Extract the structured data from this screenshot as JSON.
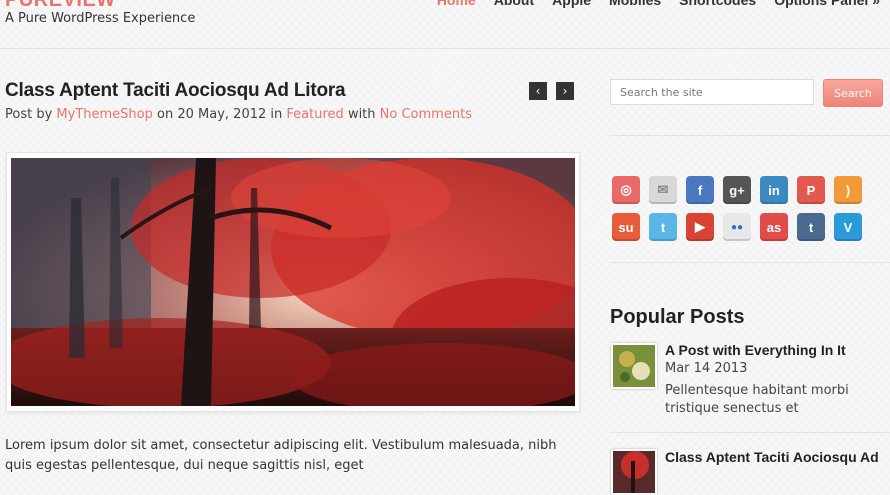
{
  "header": {
    "site_title": "PUREVIEW",
    "tagline": "A Pure WordPress Experience",
    "nav": [
      "Home",
      "About",
      "Apple",
      "Mobiles",
      "Shortcodes",
      "Options Panel »"
    ],
    "active_nav": "Home"
  },
  "post": {
    "title": "Class Aptent Taciti Aociosqu Ad Litora",
    "meta": {
      "prefix": "Post by",
      "author": "MyThemeShop",
      "on": "on",
      "date": "20 May, 2012",
      "in": "in",
      "category": "Featured",
      "with": "with",
      "comments": "No Comments"
    },
    "prev_icon": "‹",
    "next_icon": "›",
    "excerpt": "Lorem ipsum dolor sit amet, consectetur adipiscing elit. Vestibulum malesuada, nibh quis egestas pellentesque, dui neque sagittis nisl, eget"
  },
  "sidebar": {
    "search": {
      "placeholder": "Search the site",
      "button": "Search"
    },
    "social": [
      {
        "name": "dribbble-icon",
        "glyph": "◎",
        "color": "#ea6a6a"
      },
      {
        "name": "email-icon",
        "glyph": "✉",
        "color": "#d8d8d8"
      },
      {
        "name": "facebook-icon",
        "glyph": "f",
        "color": "#4a79c2"
      },
      {
        "name": "google-plus-icon",
        "glyph": "g+",
        "color": "#555555"
      },
      {
        "name": "linkedin-icon",
        "glyph": "in",
        "color": "#3b8bc2"
      },
      {
        "name": "pinterest-icon",
        "glyph": "P",
        "color": "#e4594e"
      },
      {
        "name": "rss-icon",
        "glyph": ")",
        "color": "#f09a3a"
      },
      {
        "name": "stumbleupon-icon",
        "glyph": "su",
        "color": "#ea5b3a"
      },
      {
        "name": "twitter-icon",
        "glyph": "t",
        "color": "#59b6e6"
      },
      {
        "name": "youtube-icon",
        "glyph": "▶",
        "color": "#d84334"
      },
      {
        "name": "flickr-icon",
        "glyph": "●●",
        "color": "#e8e8e8"
      },
      {
        "name": "lastfm-icon",
        "glyph": "as",
        "color": "#e14c48"
      },
      {
        "name": "tumblr-icon",
        "glyph": "t",
        "color": "#4a6a8f"
      },
      {
        "name": "vimeo-icon",
        "glyph": "V",
        "color": "#2a9ad8"
      }
    ],
    "popular_title": "Popular Posts",
    "popular_posts": [
      {
        "title": "A Post with Everything In It",
        "date": "Mar 14 2013",
        "excerpt": "Pellentesque habitant morbi tristique senectus et"
      },
      {
        "title": "Class Aptent Taciti Aociosqu Ad"
      }
    ]
  }
}
